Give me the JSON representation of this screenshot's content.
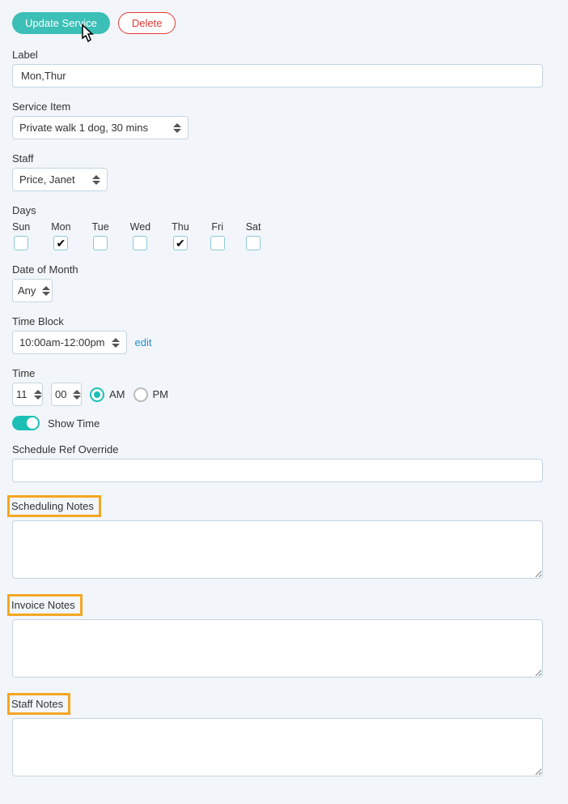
{
  "buttons": {
    "update": "Update Service",
    "delete": "Delete"
  },
  "label": {
    "title": "Label",
    "value": "Mon,Thur"
  },
  "service_item": {
    "title": "Service Item",
    "value": "Private walk 1 dog, 30 mins"
  },
  "staff": {
    "title": "Staff",
    "value": "Price, Janet"
  },
  "days": {
    "title": "Days",
    "items": [
      {
        "abbr": "Sun",
        "checked": false
      },
      {
        "abbr": "Mon",
        "checked": true
      },
      {
        "abbr": "Tue",
        "checked": false
      },
      {
        "abbr": "Wed",
        "checked": false
      },
      {
        "abbr": "Thu",
        "checked": true
      },
      {
        "abbr": "Fri",
        "checked": false
      },
      {
        "abbr": "Sat",
        "checked": false
      }
    ]
  },
  "date_of_month": {
    "title": "Date of Month",
    "value": "Any"
  },
  "time_block": {
    "title": "Time Block",
    "value": "10:00am-12:00pm",
    "edit": "edit"
  },
  "time": {
    "title": "Time",
    "hour": "11",
    "minute": "00",
    "am": "AM",
    "pm": "PM",
    "selected": "AM"
  },
  "show_time": {
    "label": "Show Time",
    "on": true
  },
  "schedule_ref": {
    "title": "Schedule Ref Override",
    "value": ""
  },
  "scheduling_notes": {
    "title": "Scheduling Notes",
    "value": ""
  },
  "invoice_notes": {
    "title": "Invoice Notes",
    "value": ""
  },
  "staff_notes": {
    "title": "Staff Notes",
    "value": ""
  }
}
